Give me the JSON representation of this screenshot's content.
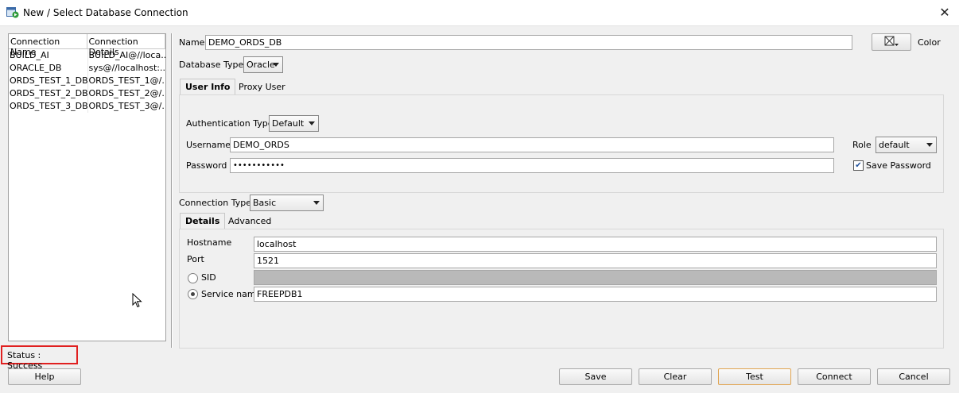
{
  "window": {
    "title": "New / Select Database Connection",
    "close_glyph": "✕"
  },
  "connections": {
    "headers": [
      "Connection Name",
      "Connection Details"
    ],
    "rows": [
      {
        "name": "BUILD_AI",
        "details": "BUILD_AI@//loca..."
      },
      {
        "name": "ORACLE_DB",
        "details": "sys@//localhost:..."
      },
      {
        "name": "ORDS_TEST_1_DB",
        "details": "ORDS_TEST_1@/..."
      },
      {
        "name": "ORDS_TEST_2_DB",
        "details": "ORDS_TEST_2@/..."
      },
      {
        "name": "ORDS_TEST_3_DB",
        "details": "ORDS_TEST_3@/..."
      }
    ]
  },
  "form": {
    "name_label": "Name",
    "name_value": "DEMO_ORDS_DB",
    "color_label": "Color",
    "db_type_label": "Database Type",
    "db_type_value": "Oracle",
    "user_tabs": [
      "User Info",
      "Proxy User"
    ],
    "auth_type_label": "Authentication Type",
    "auth_type_value": "Default",
    "username_label": "Username",
    "username_value": "DEMO_ORDS",
    "password_label": "Password",
    "password_value": "•••••••••••",
    "role_label": "Role",
    "role_value": "default",
    "save_password_label": "Save Password",
    "save_password_checked": "✔",
    "conn_type_label": "Connection Type",
    "conn_type_value": "Basic",
    "detail_tabs": [
      "Details",
      "Advanced"
    ],
    "hostname_label": "Hostname",
    "hostname_value": "localhost",
    "port_label": "Port",
    "port_value": "1521",
    "sid_label": "SID",
    "service_label": "Service name",
    "service_value": "FREEPDB1"
  },
  "status": "Status : Success",
  "buttons": {
    "help": "Help",
    "save": "Save",
    "clear": "Clear",
    "test": "Test",
    "connect": "Connect",
    "cancel": "Cancel"
  },
  "colors": {
    "status_border": "#e02020",
    "focus_border": "#e1a552"
  }
}
